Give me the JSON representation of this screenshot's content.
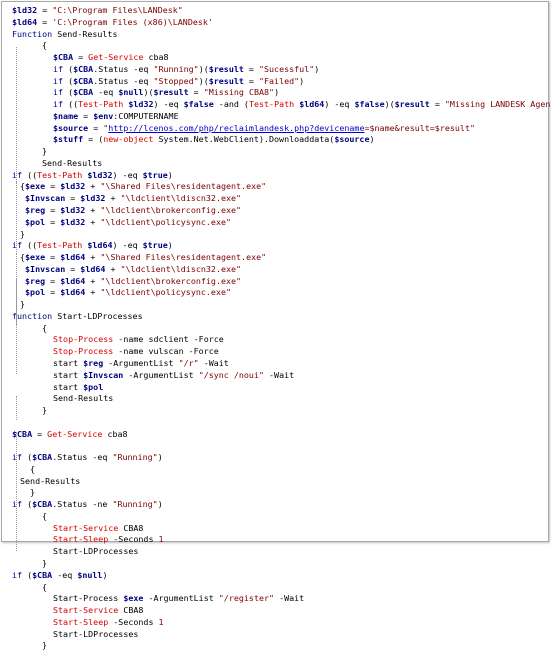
{
  "colors": {
    "variable": "#000080",
    "string": "#7b0000",
    "keyword": "#00008b",
    "command": "#d40000",
    "number": "#8b0000",
    "url": "#0000cc"
  },
  "lines": [
    {
      "indent": 0,
      "tokens": [
        [
          "var",
          "$ld32"
        ],
        [
          "plain",
          " = "
        ],
        [
          "str",
          "\"C:\\Program Files\\LANDesk\""
        ]
      ]
    },
    {
      "indent": 0,
      "tokens": [
        [
          "var",
          "$ld64"
        ],
        [
          "plain",
          " = "
        ],
        [
          "str",
          "'C:\\Program Files (x86)\\LANDesk'"
        ]
      ]
    },
    {
      "indent": 0,
      "tokens": [
        [
          "kw",
          "Function"
        ],
        [
          "plain",
          " Send-Results"
        ]
      ]
    },
    {
      "indent": 2,
      "tokens": [
        [
          "plain",
          "{"
        ]
      ]
    },
    {
      "indent": 3,
      "tokens": [
        [
          "var",
          "$CBA"
        ],
        [
          "plain",
          " = "
        ],
        [
          "cmd",
          "Get-Service"
        ],
        [
          "plain",
          " cba8"
        ]
      ]
    },
    {
      "indent": 3,
      "tokens": [
        [
          "kw",
          "if"
        ],
        [
          "plain",
          " ("
        ],
        [
          "var",
          "$CBA"
        ],
        [
          "plain",
          ".Status -eq "
        ],
        [
          "str",
          "\"Running\""
        ],
        [
          "plain",
          ")("
        ],
        [
          "var",
          "$result"
        ],
        [
          "plain",
          " = "
        ],
        [
          "str",
          "\"Sucessful\""
        ],
        [
          "plain",
          ")"
        ]
      ]
    },
    {
      "indent": 3,
      "tokens": [
        [
          "kw",
          "if"
        ],
        [
          "plain",
          " ("
        ],
        [
          "var",
          "$CBA"
        ],
        [
          "plain",
          ".Status -eq "
        ],
        [
          "str",
          "\"Stopped\""
        ],
        [
          "plain",
          ")("
        ],
        [
          "var",
          "$result"
        ],
        [
          "plain",
          " = "
        ],
        [
          "str",
          "\"Failed\""
        ],
        [
          "plain",
          ")"
        ]
      ]
    },
    {
      "indent": 3,
      "tokens": [
        [
          "kw",
          "if"
        ],
        [
          "plain",
          " ("
        ],
        [
          "var",
          "$CBA"
        ],
        [
          "plain",
          " -eq "
        ],
        [
          "var",
          "$null"
        ],
        [
          "plain",
          ")("
        ],
        [
          "var",
          "$result"
        ],
        [
          "plain",
          " = "
        ],
        [
          "str",
          "\"Missing CBA8\""
        ],
        [
          "plain",
          ")"
        ]
      ]
    },
    {
      "indent": 3,
      "tokens": [
        [
          "kw",
          "if"
        ],
        [
          "plain",
          " (("
        ],
        [
          "cmd",
          "Test-Path"
        ],
        [
          "plain",
          " "
        ],
        [
          "var",
          "$ld32"
        ],
        [
          "plain",
          ") -eq "
        ],
        [
          "var",
          "$false"
        ],
        [
          "plain",
          " -and ("
        ],
        [
          "cmd",
          "Test-Path"
        ],
        [
          "plain",
          " "
        ],
        [
          "var",
          "$ld64"
        ],
        [
          "plain",
          ") -eq "
        ],
        [
          "var",
          "$false"
        ],
        [
          "plain",
          ")("
        ],
        [
          "var",
          "$result"
        ],
        [
          "plain",
          " = "
        ],
        [
          "str",
          "\"Missing LANDESK Agent\""
        ],
        [
          "plain",
          ")"
        ]
      ]
    },
    {
      "indent": 3,
      "tokens": [
        [
          "var",
          "$name"
        ],
        [
          "plain",
          " = "
        ],
        [
          "var",
          "$env"
        ],
        [
          "plain",
          ":COMPUTERNAME"
        ]
      ]
    },
    {
      "indent": 3,
      "tokens": [
        [
          "var",
          "$source"
        ],
        [
          "plain",
          " = "
        ],
        [
          "str",
          "\""
        ],
        [
          "url",
          "http://lcenos.com/php/reclaimlandesk.php?devicename"
        ],
        [
          "str",
          "=$name&result=$result\""
        ]
      ]
    },
    {
      "indent": 3,
      "tokens": [
        [
          "var",
          "$stuff"
        ],
        [
          "plain",
          " = ("
        ],
        [
          "cmd",
          "new-object"
        ],
        [
          "plain",
          " System.Net.WebClient).Downloaddata("
        ],
        [
          "var",
          "$source"
        ],
        [
          "plain",
          ")"
        ]
      ]
    },
    {
      "indent": 2,
      "tokens": [
        [
          "plain",
          "}"
        ]
      ]
    },
    {
      "indent": 2,
      "tokens": [
        [
          "plain",
          "Send-Results"
        ]
      ]
    },
    {
      "indent": 0,
      "tokens": [
        [
          "kw",
          "if"
        ],
        [
          "plain",
          " (("
        ],
        [
          "cmd",
          "Test-Path"
        ],
        [
          "plain",
          " "
        ],
        [
          "var",
          "$ld32"
        ],
        [
          "plain",
          ") -eq "
        ],
        [
          "var",
          "$true"
        ],
        [
          "plain",
          ")"
        ]
      ]
    },
    {
      "indent": 1,
      "tokens": [
        [
          "plain",
          "{"
        ],
        [
          "var",
          "$exe"
        ],
        [
          "plain",
          " = "
        ],
        [
          "var",
          "$ld32"
        ],
        [
          "plain",
          " + "
        ],
        [
          "str",
          "\"\\Shared Files\\residentagent.exe\""
        ]
      ]
    },
    {
      "indent": 1,
      "tokens": [
        [
          "plain",
          " "
        ],
        [
          "var",
          "$Invscan"
        ],
        [
          "plain",
          " = "
        ],
        [
          "var",
          "$ld32"
        ],
        [
          "plain",
          " + "
        ],
        [
          "str",
          "\"\\ldclient\\ldiscn32.exe\""
        ]
      ]
    },
    {
      "indent": 1,
      "tokens": [
        [
          "plain",
          " "
        ],
        [
          "var",
          "$reg"
        ],
        [
          "plain",
          " = "
        ],
        [
          "var",
          "$ld32"
        ],
        [
          "plain",
          " + "
        ],
        [
          "str",
          "\"\\ldclient\\brokerconfig.exe\""
        ]
      ]
    },
    {
      "indent": 1,
      "tokens": [
        [
          "plain",
          " "
        ],
        [
          "var",
          "$pol"
        ],
        [
          "plain",
          " = "
        ],
        [
          "var",
          "$ld32"
        ],
        [
          "plain",
          " + "
        ],
        [
          "str",
          "\"\\ldclient\\policysync.exe\""
        ]
      ]
    },
    {
      "indent": 1,
      "tokens": [
        [
          "plain",
          "}"
        ]
      ]
    },
    {
      "indent": 0,
      "tokens": [
        [
          "kw",
          "if"
        ],
        [
          "plain",
          " (("
        ],
        [
          "cmd",
          "Test-Path"
        ],
        [
          "plain",
          " "
        ],
        [
          "var",
          "$ld64"
        ],
        [
          "plain",
          ") -eq "
        ],
        [
          "var",
          "$true"
        ],
        [
          "plain",
          ")"
        ]
      ]
    },
    {
      "indent": 1,
      "tokens": [
        [
          "plain",
          "{"
        ],
        [
          "var",
          "$exe"
        ],
        [
          "plain",
          " = "
        ],
        [
          "var",
          "$ld64"
        ],
        [
          "plain",
          " + "
        ],
        [
          "str",
          "\"\\Shared Files\\residentagent.exe\""
        ]
      ]
    },
    {
      "indent": 1,
      "tokens": [
        [
          "plain",
          " "
        ],
        [
          "var",
          "$Invscan"
        ],
        [
          "plain",
          " = "
        ],
        [
          "var",
          "$ld64"
        ],
        [
          "plain",
          " + "
        ],
        [
          "str",
          "\"\\ldclient\\ldiscn32.exe\""
        ]
      ]
    },
    {
      "indent": 1,
      "tokens": [
        [
          "plain",
          " "
        ],
        [
          "var",
          "$reg"
        ],
        [
          "plain",
          " = "
        ],
        [
          "var",
          "$ld64"
        ],
        [
          "plain",
          " + "
        ],
        [
          "str",
          "\"\\ldclient\\brokerconfig.exe\""
        ]
      ]
    },
    {
      "indent": 1,
      "tokens": [
        [
          "plain",
          " "
        ],
        [
          "var",
          "$pol"
        ],
        [
          "plain",
          " = "
        ],
        [
          "var",
          "$ld64"
        ],
        [
          "plain",
          " + "
        ],
        [
          "str",
          "\"\\ldclient\\policysync.exe\""
        ]
      ]
    },
    {
      "indent": 1,
      "tokens": [
        [
          "plain",
          "}"
        ]
      ]
    },
    {
      "indent": 0,
      "tokens": [
        [
          "kw",
          "function"
        ],
        [
          "plain",
          " Start-LDProcesses"
        ]
      ]
    },
    {
      "indent": 2,
      "tokens": [
        [
          "plain",
          "{"
        ]
      ]
    },
    {
      "indent": 3,
      "tokens": [
        [
          "cmd",
          "Stop-Process"
        ],
        [
          "plain",
          " -name sdclient -Force"
        ]
      ]
    },
    {
      "indent": 3,
      "tokens": [
        [
          "cmd",
          "Stop-Process"
        ],
        [
          "plain",
          " -name vulscan -Force"
        ]
      ]
    },
    {
      "indent": 3,
      "tokens": [
        [
          "plain",
          "start "
        ],
        [
          "var",
          "$reg"
        ],
        [
          "plain",
          " -ArgumentList "
        ],
        [
          "str",
          "\"/r\""
        ],
        [
          "plain",
          " -Wait"
        ]
      ]
    },
    {
      "indent": 3,
      "tokens": [
        [
          "plain",
          "start "
        ],
        [
          "var",
          "$Invscan"
        ],
        [
          "plain",
          " -ArgumentList "
        ],
        [
          "str",
          "\"/sync /noui\""
        ],
        [
          "plain",
          " -Wait"
        ]
      ]
    },
    {
      "indent": 3,
      "tokens": [
        [
          "plain",
          "start "
        ],
        [
          "var",
          "$pol"
        ]
      ]
    },
    {
      "indent": 3,
      "tokens": [
        [
          "plain",
          "Send-Results"
        ]
      ]
    },
    {
      "indent": 2,
      "tokens": [
        [
          "plain",
          "}"
        ]
      ]
    },
    {
      "indent": 0,
      "tokens": []
    },
    {
      "indent": 0,
      "tokens": [
        [
          "var",
          "$CBA"
        ],
        [
          "plain",
          " = "
        ],
        [
          "cmd",
          "Get-Service"
        ],
        [
          "plain",
          " cba8"
        ]
      ]
    },
    {
      "indent": 0,
      "tokens": []
    },
    {
      "indent": 0,
      "tokens": [
        [
          "kw",
          "if"
        ],
        [
          "plain",
          " ("
        ],
        [
          "var",
          "$CBA"
        ],
        [
          "plain",
          ".Status -eq "
        ],
        [
          "str",
          "\"Running\""
        ],
        [
          "plain",
          ")"
        ]
      ]
    },
    {
      "indent": 1,
      "tokens": [
        [
          "plain",
          "  {"
        ]
      ]
    },
    {
      "indent": 1,
      "tokens": [
        [
          "plain",
          "Send-Results"
        ]
      ]
    },
    {
      "indent": 1,
      "tokens": [
        [
          "plain",
          "  }"
        ]
      ]
    },
    {
      "indent": 0,
      "tokens": [
        [
          "kw",
          "if"
        ],
        [
          "plain",
          " ("
        ],
        [
          "var",
          "$CBA"
        ],
        [
          "plain",
          ".Status -ne "
        ],
        [
          "str",
          "\"Running\""
        ],
        [
          "plain",
          ")"
        ]
      ]
    },
    {
      "indent": 2,
      "tokens": [
        [
          "plain",
          "{"
        ]
      ]
    },
    {
      "indent": 3,
      "tokens": [
        [
          "cmd",
          "Start-Service"
        ],
        [
          "plain",
          " CBA8"
        ]
      ]
    },
    {
      "indent": 3,
      "tokens": [
        [
          "cmd",
          "Start-Sleep"
        ],
        [
          "plain",
          " -Seconds "
        ],
        [
          "num",
          "1"
        ]
      ]
    },
    {
      "indent": 3,
      "tokens": [
        [
          "plain",
          "Start-LDProcesses"
        ]
      ]
    },
    {
      "indent": 2,
      "tokens": [
        [
          "plain",
          "}"
        ]
      ]
    },
    {
      "indent": 0,
      "tokens": [
        [
          "kw",
          "if"
        ],
        [
          "plain",
          " ("
        ],
        [
          "var",
          "$CBA"
        ],
        [
          "plain",
          " -eq "
        ],
        [
          "var",
          "$null"
        ],
        [
          "plain",
          ")"
        ]
      ]
    },
    {
      "indent": 2,
      "tokens": [
        [
          "plain",
          "{"
        ]
      ]
    },
    {
      "indent": 3,
      "tokens": [
        [
          "plain",
          "Start-Process "
        ],
        [
          "var",
          "$exe"
        ],
        [
          "plain",
          " -ArgumentList "
        ],
        [
          "str",
          "\"/register\""
        ],
        [
          "plain",
          " -Wait"
        ]
      ]
    },
    {
      "indent": 3,
      "tokens": [
        [
          "cmd",
          "Start-Service"
        ],
        [
          "plain",
          " CBA8"
        ]
      ]
    },
    {
      "indent": 3,
      "tokens": [
        [
          "cmd",
          "Start-Sleep"
        ],
        [
          "plain",
          " -Seconds "
        ],
        [
          "num",
          "1"
        ]
      ]
    },
    {
      "indent": 3,
      "tokens": [
        [
          "plain",
          "Start-LDProcesses"
        ]
      ]
    },
    {
      "indent": 2,
      "tokens": [
        [
          "plain",
          "}"
        ]
      ]
    }
  ]
}
